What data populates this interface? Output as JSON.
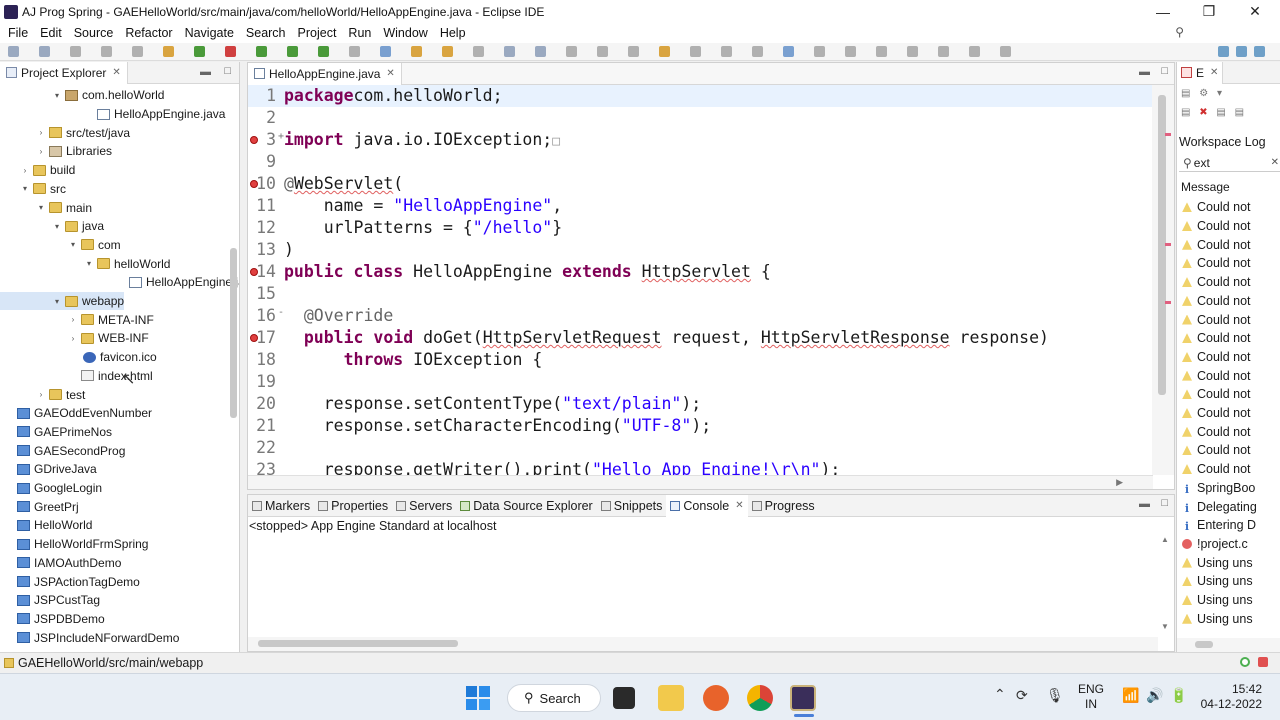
{
  "window": {
    "title": "AJ Prog Spring - GAEHelloWorld/src/main/java/com/helloWorld/HelloAppEngine.java - Eclipse IDE",
    "minimize": "—",
    "maximize": "❐",
    "close": "✕"
  },
  "menu": [
    "File",
    "Edit",
    "Source",
    "Refactor",
    "Navigate",
    "Search",
    "Project",
    "Run",
    "Window",
    "Help"
  ],
  "explorer": {
    "tab": "Project Explorer",
    "items": [
      {
        "label": "com.helloWorld",
        "arrow": "▾",
        "icon": "package-icon"
      },
      {
        "label": "HelloAppEngine.java",
        "arrow": "",
        "icon": "java-file-icon"
      },
      {
        "label": "src/test/java",
        "arrow": "›",
        "icon": "source-folder-icon"
      },
      {
        "label": "Libraries",
        "arrow": "›",
        "icon": "library-icon"
      },
      {
        "label": "build",
        "arrow": "›",
        "icon": "folder-icon"
      },
      {
        "label": "src",
        "arrow": "▾",
        "icon": "folder-icon"
      },
      {
        "label": "main",
        "arrow": "▾",
        "icon": "folder-icon"
      },
      {
        "label": "java",
        "arrow": "▾",
        "icon": "folder-icon"
      },
      {
        "label": "com",
        "arrow": "▾",
        "icon": "folder-icon"
      },
      {
        "label": "helloWorld",
        "arrow": "▾",
        "icon": "folder-icon"
      },
      {
        "label": "HelloAppEngine.ja",
        "arrow": "",
        "icon": "java-file-icon"
      },
      {
        "label": "webapp",
        "arrow": "▾",
        "icon": "folder-icon"
      },
      {
        "label": "META-INF",
        "arrow": "›",
        "icon": "folder-icon"
      },
      {
        "label": "WEB-INF",
        "arrow": "›",
        "icon": "folder-icon"
      },
      {
        "label": "favicon.ico",
        "arrow": "",
        "icon": "ico-file-icon"
      },
      {
        "label": "index.html",
        "arrow": "",
        "icon": "html-file-icon"
      },
      {
        "label": "test",
        "arrow": "›",
        "icon": "folder-icon"
      },
      {
        "label": "GAEOddEvenNumber",
        "arrow": "",
        "icon": "project-icon"
      },
      {
        "label": "GAEPrimeNos",
        "arrow": "",
        "icon": "project-icon"
      },
      {
        "label": "GAESecondProg",
        "arrow": "",
        "icon": "project-icon"
      },
      {
        "label": "GDriveJava",
        "arrow": "",
        "icon": "project-icon"
      },
      {
        "label": "GoogleLogin",
        "arrow": "",
        "icon": "project-icon"
      },
      {
        "label": "GreetPrj",
        "arrow": "",
        "icon": "project-icon"
      },
      {
        "label": "HelloWorld",
        "arrow": "",
        "icon": "project-icon"
      },
      {
        "label": "HelloWorldFrmSpring",
        "arrow": "",
        "icon": "project-icon"
      },
      {
        "label": "IAMOAuthDemo",
        "arrow": "",
        "icon": "project-icon"
      },
      {
        "label": "JSPActionTagDemo",
        "arrow": "",
        "icon": "project-icon"
      },
      {
        "label": "JSPCustTag",
        "arrow": "",
        "icon": "project-icon"
      },
      {
        "label": "JSPDBDemo",
        "arrow": "",
        "icon": "project-icon"
      },
      {
        "label": "JSPIncludeNForwardDemo",
        "arrow": "",
        "icon": "project-icon"
      }
    ]
  },
  "editor": {
    "tab": "HelloAppEngine.java",
    "lines": [
      {
        "n": "1",
        "fold": "",
        "marker": false,
        "current": true,
        "tokens": [
          [
            "kw",
            "package"
          ],
          [
            "",
            "com.helloWorld;"
          ]
        ]
      },
      {
        "n": "2",
        "fold": "",
        "marker": false,
        "tokens": []
      },
      {
        "n": "3",
        "fold": "+",
        "marker": true,
        "tokens": [
          [
            "kw",
            "import"
          ],
          [
            "",
            " java.io.IOException;"
          ],
          [
            "box",
            "□"
          ]
        ]
      },
      {
        "n": "9",
        "fold": "",
        "marker": false,
        "tokens": []
      },
      {
        "n": "10",
        "fold": "",
        "marker": true,
        "tokens": [
          [
            "ann",
            "@"
          ],
          [
            "und",
            "WebServlet"
          ],
          [
            "",
            "("
          ]
        ]
      },
      {
        "n": "11",
        "fold": "",
        "marker": false,
        "tokens": [
          [
            "",
            "    name = "
          ],
          [
            "str",
            "\"HelloAppEngine\""
          ],
          [
            "",
            ","
          ]
        ]
      },
      {
        "n": "12",
        "fold": "",
        "marker": false,
        "tokens": [
          [
            "",
            "    urlPatterns = {"
          ],
          [
            "str",
            "\"/hello\""
          ],
          [
            "",
            "}"
          ]
        ]
      },
      {
        "n": "13",
        "fold": "",
        "marker": false,
        "tokens": [
          [
            "",
            ")"
          ]
        ]
      },
      {
        "n": "14",
        "fold": "",
        "marker": true,
        "tokens": [
          [
            "kw",
            "public"
          ],
          [
            "",
            " "
          ],
          [
            "kw",
            "class"
          ],
          [
            "",
            " HelloAppEngine "
          ],
          [
            "kw",
            "extends"
          ],
          [
            "",
            " "
          ],
          [
            "und",
            "HttpServlet"
          ],
          [
            "",
            " {"
          ]
        ]
      },
      {
        "n": "15",
        "fold": "",
        "marker": false,
        "tokens": []
      },
      {
        "n": "16",
        "fold": "-",
        "marker": false,
        "tokens": [
          [
            "ann",
            "  @Override"
          ]
        ]
      },
      {
        "n": "17",
        "fold": "",
        "marker": true,
        "tokens": [
          [
            "",
            "  "
          ],
          [
            "kw",
            "public"
          ],
          [
            "",
            " "
          ],
          [
            "kw",
            "void"
          ],
          [
            "",
            " doGet("
          ],
          [
            "und",
            "HttpServletRequest"
          ],
          [
            "",
            " request, "
          ],
          [
            "und",
            "HttpServletResponse"
          ],
          [
            "",
            " response)"
          ]
        ]
      },
      {
        "n": "18",
        "fold": "",
        "marker": false,
        "tokens": [
          [
            "",
            "      "
          ],
          [
            "kw",
            "throws"
          ],
          [
            "",
            " IOException {"
          ]
        ]
      },
      {
        "n": "19",
        "fold": "",
        "marker": false,
        "tokens": []
      },
      {
        "n": "20",
        "fold": "",
        "marker": false,
        "tokens": [
          [
            "",
            "    response.setContentType("
          ],
          [
            "str",
            "\"text/plain\""
          ],
          [
            "",
            ");"
          ]
        ]
      },
      {
        "n": "21",
        "fold": "",
        "marker": false,
        "tokens": [
          [
            "",
            "    response.setCharacterEncoding("
          ],
          [
            "str",
            "\"UTF-8\""
          ],
          [
            "",
            ");"
          ]
        ]
      },
      {
        "n": "22",
        "fold": "",
        "marker": false,
        "tokens": []
      },
      {
        "n": "23",
        "fold": "",
        "marker": false,
        "tokens": [
          [
            "",
            "    response.getWriter().print("
          ],
          [
            "str",
            "\"Hello App Engine!\\r\\n\""
          ],
          [
            "",
            ");"
          ]
        ]
      }
    ]
  },
  "console": {
    "tabs": [
      "Markers",
      "Properties",
      "Servers",
      "Data Source Explorer",
      "Snippets",
      "Console",
      "Progress"
    ],
    "active_tab": "Console",
    "status": "<stopped> App Engine Standard at localhost"
  },
  "errorlog": {
    "tab": "E",
    "title": "Workspace Log",
    "filter_value": "ext",
    "column": "Message",
    "rows": [
      {
        "type": "warn",
        "text": "Could not"
      },
      {
        "type": "warn",
        "text": "Could not"
      },
      {
        "type": "warn",
        "text": "Could not"
      },
      {
        "type": "warn",
        "text": "Could not"
      },
      {
        "type": "warn",
        "text": "Could not"
      },
      {
        "type": "warn",
        "text": "Could not"
      },
      {
        "type": "warn",
        "text": "Could not"
      },
      {
        "type": "warn",
        "text": "Could not"
      },
      {
        "type": "warn",
        "text": "Could not"
      },
      {
        "type": "warn",
        "text": "Could not"
      },
      {
        "type": "warn",
        "text": "Could not"
      },
      {
        "type": "warn",
        "text": "Could not"
      },
      {
        "type": "warn",
        "text": "Could not"
      },
      {
        "type": "warn",
        "text": "Could not"
      },
      {
        "type": "warn",
        "text": "Could not"
      },
      {
        "type": "info",
        "text": "SpringBoo"
      },
      {
        "type": "info",
        "text": "Delegating"
      },
      {
        "type": "info",
        "text": "Entering D"
      },
      {
        "type": "err",
        "text": "!project.c"
      },
      {
        "type": "warn",
        "text": "Using uns"
      },
      {
        "type": "warn",
        "text": "Using uns"
      },
      {
        "type": "warn",
        "text": "Using uns"
      },
      {
        "type": "warn",
        "text": "Using uns"
      }
    ]
  },
  "statusbar": {
    "path": "GAEHelloWorld/src/main/webapp"
  },
  "taskbar": {
    "search_label": "Search",
    "lang_top": "ENG",
    "lang_bottom": "IN",
    "time": "15:42",
    "date": "04-12-2022"
  },
  "colors": {
    "keyword": "#7f0055",
    "string": "#2a00ff",
    "annotation": "#646464"
  }
}
